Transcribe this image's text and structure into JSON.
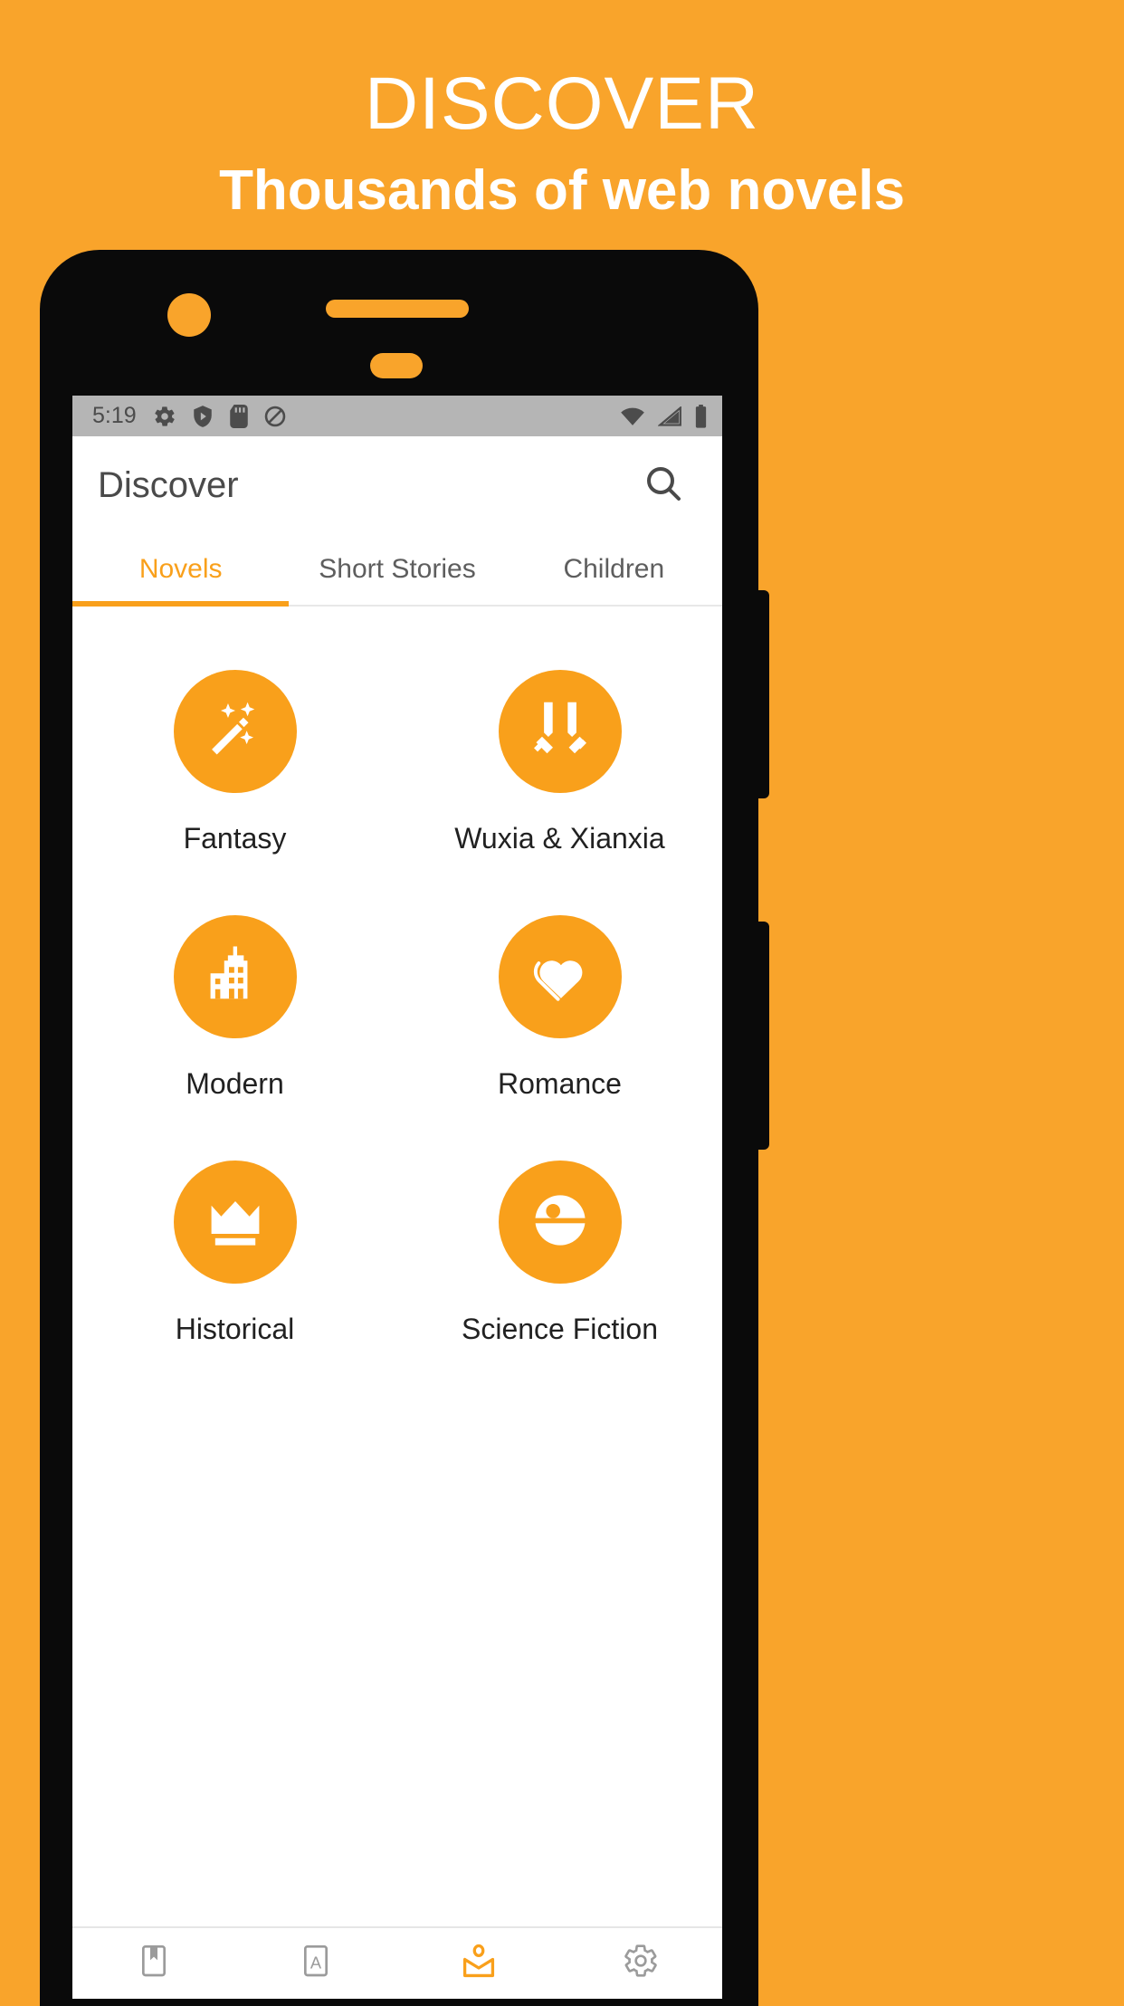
{
  "promo": {
    "title": "DISCOVER",
    "subtitle": "Thousands of web novels",
    "background_color": "#F9A42B",
    "text_color": "#FFFFFF"
  },
  "status_bar": {
    "time": "5:19",
    "left_icons": [
      "gear-icon",
      "play-protect-shield-icon",
      "sd-card-icon",
      "do-not-disturb-icon"
    ],
    "right_icons": [
      "wifi-icon",
      "cellular-signal-icon",
      "battery-icon"
    ],
    "background_color": "#B5B5B5"
  },
  "app_bar": {
    "title": "Discover",
    "search_icon": "search-icon"
  },
  "tabs": [
    {
      "label": "Novels",
      "active": true
    },
    {
      "label": "Short Stories",
      "active": false
    },
    {
      "label": "Children",
      "active": false
    }
  ],
  "accent_color": "#F9A01B",
  "categories": [
    {
      "label": "Fantasy",
      "icon": "magic-wand-icon"
    },
    {
      "label": "Wuxia & Xianxia",
      "icon": "crossed-swords-icon"
    },
    {
      "label": "Modern",
      "icon": "city-building-icon"
    },
    {
      "label": "Romance",
      "icon": "heart-icon"
    },
    {
      "label": "Historical",
      "icon": "crown-icon"
    },
    {
      "label": "Science Fiction",
      "icon": "death-star-icon"
    }
  ],
  "bottom_nav": [
    {
      "name": "library",
      "icon": "bookmark-icon",
      "active": false
    },
    {
      "name": "text",
      "icon": "letter-a-icon",
      "active": false
    },
    {
      "name": "discover",
      "icon": "person-reading-icon",
      "active": true
    },
    {
      "name": "settings",
      "icon": "gear-icon",
      "active": false
    }
  ]
}
